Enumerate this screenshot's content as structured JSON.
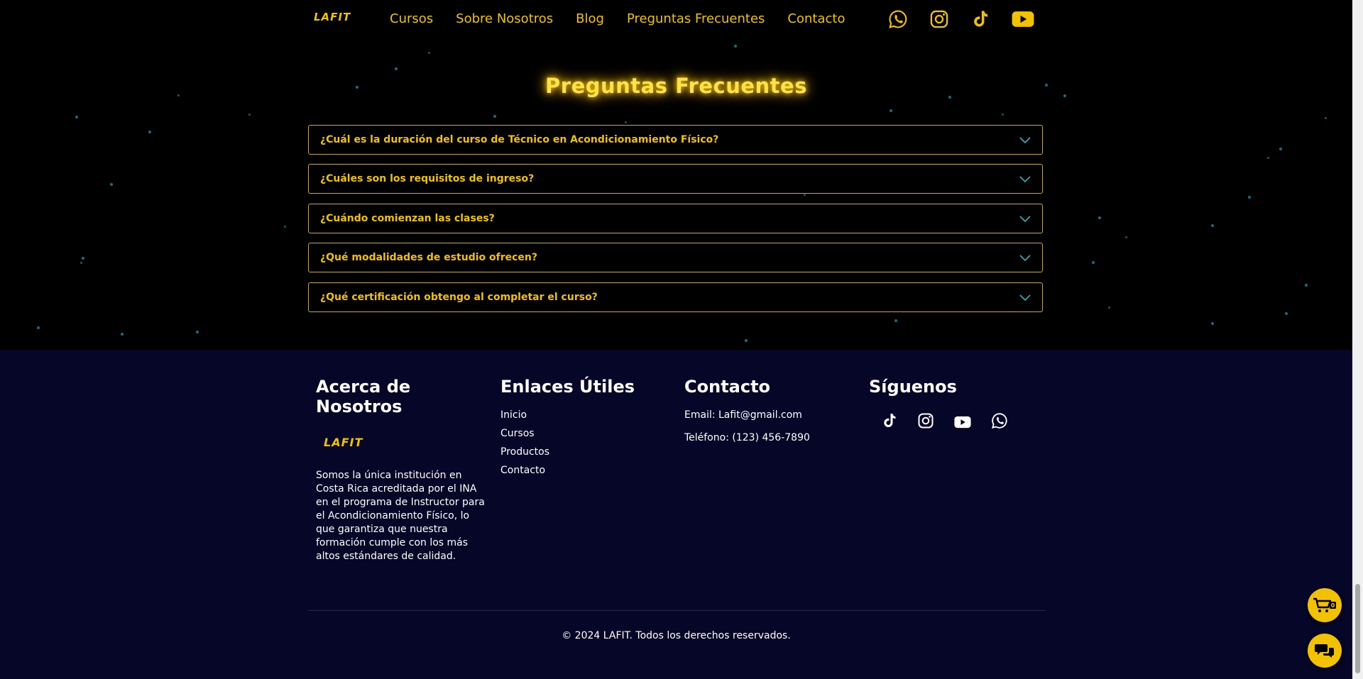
{
  "brand": {
    "logo_text": "LAFIT",
    "accent": "#f2c200",
    "footer_bg": "#060628"
  },
  "nav": {
    "links": [
      "Cursos",
      "Sobre Nosotros",
      "Blog",
      "Preguntas Frecuentes",
      "Contacto"
    ],
    "social_icons": [
      "whatsapp-icon",
      "instagram-icon",
      "tiktok-icon",
      "youtube-icon"
    ]
  },
  "faq": {
    "title": "Preguntas Frecuentes",
    "items": [
      {
        "question": "¿Cuál es la duración del curso de Técnico en Acondicionamiento Físico?"
      },
      {
        "question": "¿Cuáles son los requisitos de ingreso?"
      },
      {
        "question": "¿Cuándo comienzan las clases?"
      },
      {
        "question": "¿Qué modalidades de estudio ofrecen?"
      },
      {
        "question": "¿Qué certificación obtengo al completar el curso?"
      }
    ]
  },
  "footer": {
    "about": {
      "title": "Acerca de Nosotros",
      "description": "Somos la única institución en Costa Rica acreditada por el INA en el programa de Instructor para el Acondicionamiento Físico, lo que garantiza que nuestra formación cumple con los más altos estándares de calidad."
    },
    "links": {
      "title": "Enlaces Útiles",
      "items": [
        "Inicio",
        "Cursos",
        "Productos",
        "Contacto"
      ]
    },
    "contact": {
      "title": "Contacto",
      "email": "Email: Lafit@gmail.com",
      "phone": "Teléfono: (123) 456-7890"
    },
    "follow": {
      "title": "Síguenos",
      "icons": [
        "tiktok-icon",
        "instagram-icon",
        "youtube-icon",
        "whatsapp-icon"
      ]
    },
    "copyright": "© 2024 LAFIT. Todos los derechos reservados."
  },
  "floating": {
    "cart_icon": "cart-icon",
    "chat_icon": "chat-icon"
  }
}
